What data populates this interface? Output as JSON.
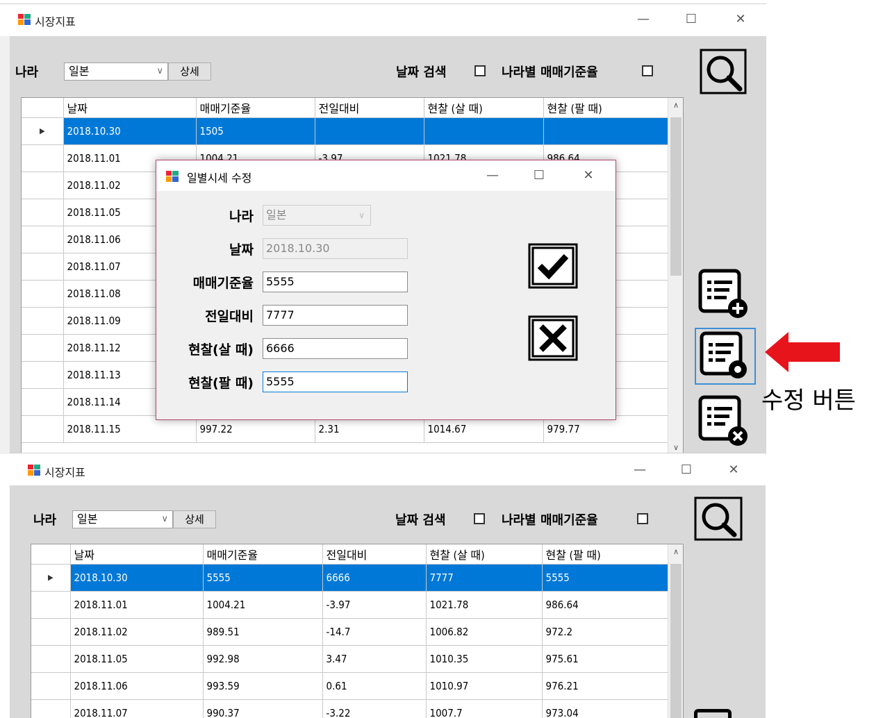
{
  "window_top": {
    "title": "시장지표",
    "country_label": "나라",
    "country_value": "일본",
    "detail_button": "상세",
    "date_search_label": "날짜 검색",
    "per_country_label": "나라별 매매기준율",
    "grid": {
      "headers": [
        "날짜",
        "매매기준율",
        "전일대비",
        "현찰 (살 때)",
        "현찰 (팔 때)"
      ],
      "rows": [
        [
          "2018.10.30",
          "1505",
          "",
          "",
          ""
        ],
        [
          "2018.11.01",
          "1004.21",
          "-3.97",
          "1021.78",
          "986.64"
        ],
        [
          "2018.11.02",
          "",
          "",
          "",
          ""
        ],
        [
          "2018.11.05",
          "",
          "",
          "",
          ""
        ],
        [
          "2018.11.06",
          "",
          "",
          "",
          ""
        ],
        [
          "2018.11.07",
          "",
          "",
          "",
          ""
        ],
        [
          "2018.11.08",
          "",
          "",
          "",
          ""
        ],
        [
          "2018.11.09",
          "",
          "",
          "",
          ""
        ],
        [
          "2018.11.12",
          "",
          "",
          "",
          ""
        ],
        [
          "2018.11.13",
          "",
          "",
          "",
          ""
        ],
        [
          "2018.11.14",
          "",
          "",
          "",
          ""
        ],
        [
          "2018.11.15",
          "997.22",
          "2.31",
          "1014.67",
          "979.77"
        ]
      ]
    }
  },
  "dialog": {
    "title": "일별시세 수정",
    "fields": [
      {
        "label": "나라",
        "value": "일본"
      },
      {
        "label": "날짜",
        "value": "2018.10.30"
      },
      {
        "label": "매매기준율",
        "value": "5555"
      },
      {
        "label": "전일대비",
        "value": "7777"
      },
      {
        "label": "현찰(살 때)",
        "value": "6666"
      },
      {
        "label": "현찰(팔 때)",
        "value": "5555"
      }
    ]
  },
  "annotation": {
    "text": "수정 버튼",
    "arrow_color": "#e8141c"
  },
  "window_bottom": {
    "title": "시장지표",
    "country_label": "나라",
    "country_value": "일본",
    "detail_button": "상세",
    "date_search_label": "날짜 검색",
    "per_country_label": "나라별 매매기준율",
    "grid": {
      "headers": [
        "날짜",
        "매매기준율",
        "전일대비",
        "현찰 (살 때)",
        "현찰 (팔 때)"
      ],
      "rows": [
        [
          "2018.10.30",
          "5555",
          "6666",
          "7777",
          "5555"
        ],
        [
          "2018.11.01",
          "1004.21",
          "-3.97",
          "1021.78",
          "986.64"
        ],
        [
          "2018.11.02",
          "989.51",
          "-14.7",
          "1006.82",
          "972.2"
        ],
        [
          "2018.11.05",
          "992.98",
          "3.47",
          "1010.35",
          "975.61"
        ],
        [
          "2018.11.06",
          "993.59",
          "0.61",
          "1010.97",
          "976.21"
        ],
        [
          "2018.11.07",
          "990.37",
          "-3.22",
          "1007.7",
          "973.04"
        ]
      ]
    }
  },
  "colors": {
    "selection": "#0078d7",
    "client_bg": "#d9d9d9",
    "dialog_border": "#b0486a"
  }
}
